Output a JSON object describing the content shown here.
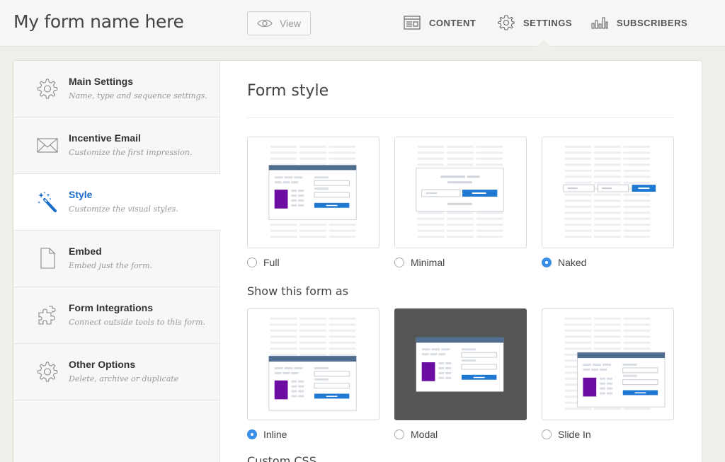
{
  "header": {
    "form_name": "My form name here",
    "view_label": "View",
    "nav": [
      {
        "label": "CONTENT",
        "icon": "content-icon"
      },
      {
        "label": "SETTINGS",
        "icon": "gear-icon",
        "active": true
      },
      {
        "label": "SUBSCRIBERS",
        "icon": "bar-chart-icon"
      }
    ]
  },
  "sidebar": {
    "items": [
      {
        "title": "Main Settings",
        "desc": "Name, type and sequence settings.",
        "icon": "gear-icon"
      },
      {
        "title": "Incentive Email",
        "desc": "Customize the first impression.",
        "icon": "envelope-icon"
      },
      {
        "title": "Style",
        "desc": "Customize the visual styles.",
        "icon": "magic-wand-icon",
        "active": true
      },
      {
        "title": "Embed",
        "desc": "Embed just the form.",
        "icon": "document-icon"
      },
      {
        "title": "Form Integrations",
        "desc": "Connect outside tools to this form.",
        "icon": "puzzle-icon"
      },
      {
        "title": "Other Options",
        "desc": "Delete, archive or duplicate",
        "icon": "gear-icon"
      }
    ]
  },
  "main": {
    "form_style_title": "Form style",
    "form_style_options": [
      {
        "label": "Full",
        "selected": false
      },
      {
        "label": "Minimal",
        "selected": false
      },
      {
        "label": "Naked",
        "selected": true
      }
    ],
    "show_as_title": "Show this form as",
    "show_as_options": [
      {
        "label": "Inline",
        "selected": true
      },
      {
        "label": "Modal",
        "selected": false
      },
      {
        "label": "Slide In",
        "selected": false
      }
    ],
    "custom_css_title": "Custom CSS"
  },
  "colors": {
    "accent": "#1a6dca",
    "button_blue": "#1f78d1",
    "form_header": "#4f6d8f",
    "image_purple": "#6a0da0",
    "modal_backdrop": "#555555"
  }
}
